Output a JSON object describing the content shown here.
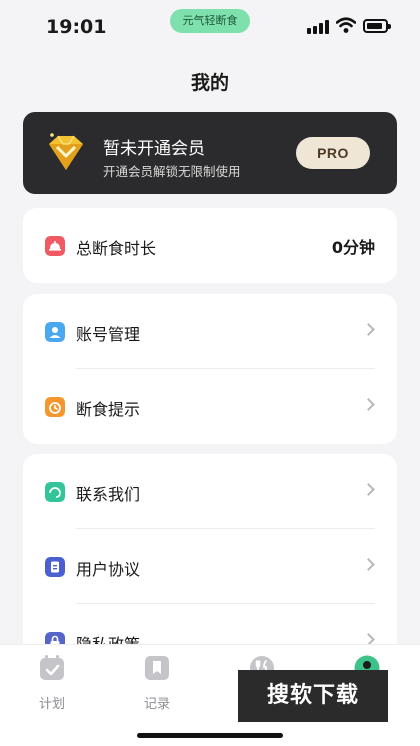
{
  "status_bar": {
    "time": "19:01",
    "app_pill": "元气轻断食"
  },
  "page": {
    "title": "我的"
  },
  "vip": {
    "title": "暂未开通会员",
    "subtitle": "开通会员解锁无限制使用",
    "button": "PRO"
  },
  "stats": {
    "label": "总断食时长",
    "value": "0分钟",
    "icon": "bell-icon",
    "color": "#ef5a63"
  },
  "menu_group_1": [
    {
      "label": "账号管理",
      "icon": "user-icon",
      "color": "#4aa8f0"
    },
    {
      "label": "断食提示",
      "icon": "alarm-icon",
      "color": "#f5962f"
    }
  ],
  "menu_group_2": [
    {
      "label": "联系我们",
      "icon": "headset-icon",
      "color": "#34c49a"
    },
    {
      "label": "用户协议",
      "icon": "document-icon",
      "color": "#4b5fd1"
    },
    {
      "label": "隐私政策",
      "icon": "lock-icon",
      "color": "#5566c8"
    }
  ],
  "tabbar": {
    "tabs": [
      {
        "label": "计划",
        "icon": "calendar-icon"
      },
      {
        "label": "记录",
        "icon": "bookmark-icon"
      },
      {
        "label": "",
        "icon": "utensils-icon"
      },
      {
        "label": "",
        "icon": "profile-icon",
        "active_color": "#3ec28a"
      }
    ]
  },
  "watermark": "搜软下载"
}
